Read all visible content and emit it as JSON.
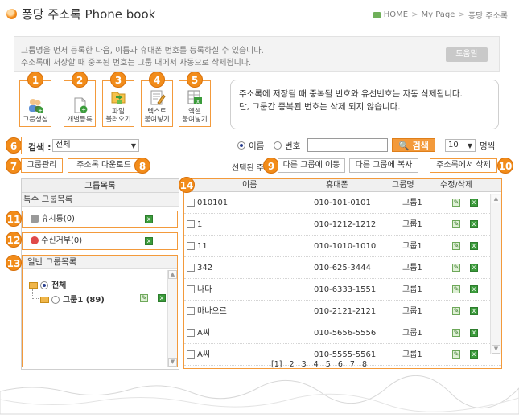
{
  "header": {
    "title": "퐁당 주소록  Phone book",
    "breadcrumb": [
      "HOME",
      "My Page",
      "퐁당 주소록"
    ]
  },
  "info": {
    "line1": "그룹명을 먼저 등록한 다음, 이름과 휴대폰 번호를 등록하실 수 있습니다.",
    "line2": "주소록에 저장할 때 중복된 번호는 그룹 내에서 자동으로 삭제됩니다.",
    "help_label": "도움말"
  },
  "tools": [
    {
      "num": "1",
      "label": "그룹생성",
      "icon": "group-icon"
    },
    {
      "num": "2",
      "label": "개별등록",
      "icon": "new-doc-icon"
    },
    {
      "num": "3",
      "label": "파일\n불러오기",
      "icon": "file-import-icon"
    },
    {
      "num": "4",
      "label": "텍스트\n붙여넣기",
      "icon": "text-paste-icon"
    },
    {
      "num": "5",
      "label": "엑셀\n붙여넣기",
      "icon": "excel-paste-icon"
    }
  ],
  "notice": {
    "line1": "주소록에 저장될 때 중복될 번호와 유선번호는 자동 삭제됩니다.",
    "line2": "단, 그룹간 중복된 번호는 삭제 되지 않습니다."
  },
  "search": {
    "num": "6",
    "label": "검색 :",
    "group_select": "전체",
    "radio_name": "이름",
    "radio_phone": "번호",
    "button": "검색",
    "page_size": "10",
    "page_size_unit": "명씩"
  },
  "actions": {
    "group_manage": "그룹관리",
    "download": "주소록 다운로드",
    "selected_prefix": "선택된 주소",
    "move": "다른 그룹에 이동",
    "copy": "다른 그룹에 복사",
    "delete": "주소록에서 삭제",
    "nums": {
      "group_manage": "7",
      "download": "8",
      "selected": "9",
      "delete": "10"
    }
  },
  "left_panel": {
    "title": "그룹목록",
    "special_header": "특수 그룹목록",
    "trash": "휴지통(0)",
    "reject": "수신거부(0)",
    "general_header": "일반 그룹목록",
    "all": "전체",
    "group1": "그룹1 (89)",
    "nums": {
      "trash": "11",
      "reject": "12",
      "general": "13"
    }
  },
  "table": {
    "num": "14",
    "columns": [
      "이름",
      "휴대폰",
      "그룹명",
      "수정/삭제"
    ],
    "rows": [
      {
        "name": "010101",
        "phone": "010-101-0101",
        "group": "그룹1"
      },
      {
        "name": "1",
        "phone": "010-1212-1212",
        "group": "그룹1"
      },
      {
        "name": "11",
        "phone": "010-1010-1010",
        "group": "그룹1"
      },
      {
        "name": "342",
        "phone": "010-625-3444",
        "group": "그룹1"
      },
      {
        "name": "나다",
        "phone": "010-6333-1551",
        "group": "그룹1"
      },
      {
        "name": "마나으르",
        "phone": "010-2121-2121",
        "group": "그룹1"
      },
      {
        "name": "A씨",
        "phone": "010-5656-5556",
        "group": "그룹1"
      },
      {
        "name": "A씨",
        "phone": "010-5555-5561",
        "group": "그룹1"
      }
    ],
    "pages": [
      "[1]",
      "2",
      "3",
      "4",
      "5",
      "6",
      "7",
      "8"
    ]
  },
  "colors": {
    "accent": "#f28c1a",
    "border_accent": "#f39a3b",
    "green": "#3b9c3b"
  }
}
